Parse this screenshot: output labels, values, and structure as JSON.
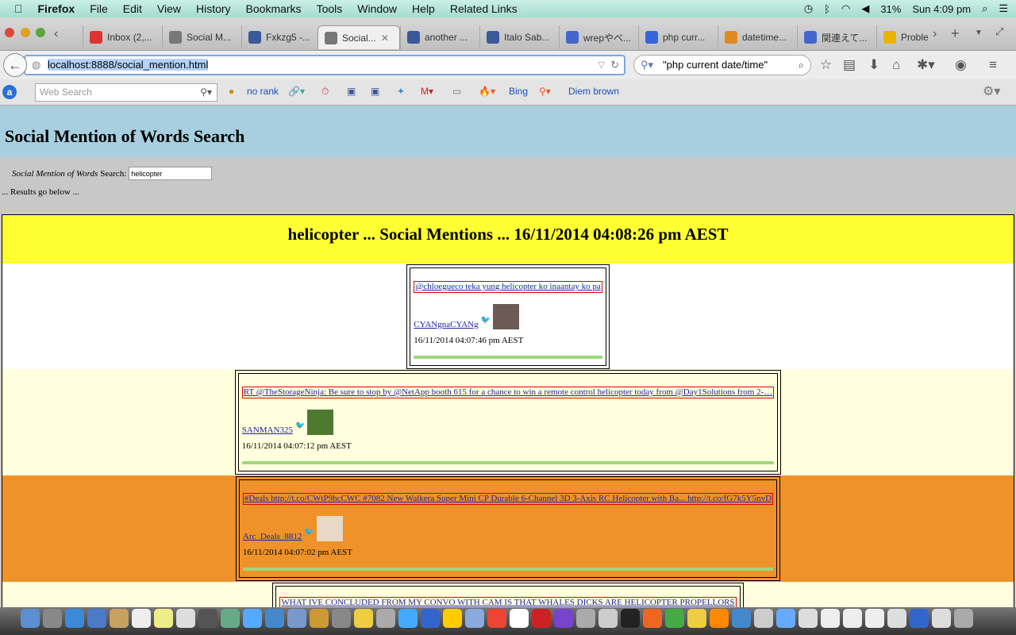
{
  "menubar": {
    "app": "Firefox",
    "items": [
      "File",
      "Edit",
      "View",
      "History",
      "Bookmarks",
      "Tools",
      "Window",
      "Help",
      "Related Links"
    ],
    "battery": "31%",
    "clock": "Sun 4:09 pm"
  },
  "tabs": [
    {
      "label": "Inbox (2,...",
      "icon": "gmail-icon",
      "color": "#d33"
    },
    {
      "label": "Social M...",
      "icon": "globe-icon",
      "color": "#777"
    },
    {
      "label": "Fxkzg5 -...",
      "icon": "facebook-icon",
      "color": "#3b5998"
    },
    {
      "label": "Social...",
      "icon": "globe-icon",
      "color": "#777",
      "active": true
    },
    {
      "label": "another ...",
      "icon": "facebook-icon",
      "color": "#3b5998"
    },
    {
      "label": "Italo Sab...",
      "icon": "facebook-icon",
      "color": "#3b5998"
    },
    {
      "label": "wrepやべ...",
      "icon": "site-icon",
      "color": "#4466cc"
    },
    {
      "label": "php curr...",
      "icon": "info-icon",
      "color": "#3366dd"
    },
    {
      "label": "datetime...",
      "icon": "stackoverflow-icon",
      "color": "#e08a1e"
    },
    {
      "label": "関連えて...",
      "icon": "site-icon",
      "color": "#4466cc"
    },
    {
      "label": "Proble",
      "icon": "warning-icon",
      "color": "#e8b400"
    }
  ],
  "nav": {
    "url_host": "localhost:8888/social_mention.html",
    "search_value": "\"php current date/time\""
  },
  "bookmarks": {
    "web_search_placeholder": "Web Search",
    "items": [
      "no rank",
      "Bing",
      "Diem brown"
    ]
  },
  "page": {
    "title": "Social Mention of Words Search",
    "search_label_italic": "Social Mention of Words",
    "search_label": "Search:",
    "search_value": "helicopter",
    "results_note": "... Results go below ...",
    "results_heading": "helicopter ... Social Mentions ... 16/11/2014 04:08:26 pm AEST",
    "mentions": [
      {
        "text": "@chloegueco teka yung helicopter ko inaantay ko pa",
        "user": "CYANgnaCYANg",
        "time": "16/11/2014 04:07:46 pm AEST",
        "bg": "#ffffff",
        "avatar": "#6b5a55"
      },
      {
        "text": "RT @TheStorageNinja: Be sure to stop by @NetApp booth 615 for a chance to win a remote control helicopter today from @Day1Solutions from 2-…",
        "user": "SANMAN325",
        "time": "16/11/2014 04:07:12 pm AEST",
        "bg": "#ffffdd",
        "avatar": "#4e7a30"
      },
      {
        "text": "#Deals http://t.co/CWtP9hcCWC #7082 New Walkera Super Mini CP Durable 6-Channel 3D 3-Axis RC Helicopter with Ba... http://t.co/fG7k5Y5nvD",
        "user": "Arc_Deals_8812",
        "time": "16/11/2014 04:07:02 pm AEST",
        "bg": "#ee9229",
        "avatar": "#e8d8c8"
      },
      {
        "text": "WHAT IVE CONCLUDED FROM MY CONVO WITH CAM IS THAT WHALES DICKS ARE HELICOPTER PROPELLORS",
        "user": "",
        "time": "",
        "bg": "#ffffdd",
        "avatar": ""
      }
    ]
  }
}
